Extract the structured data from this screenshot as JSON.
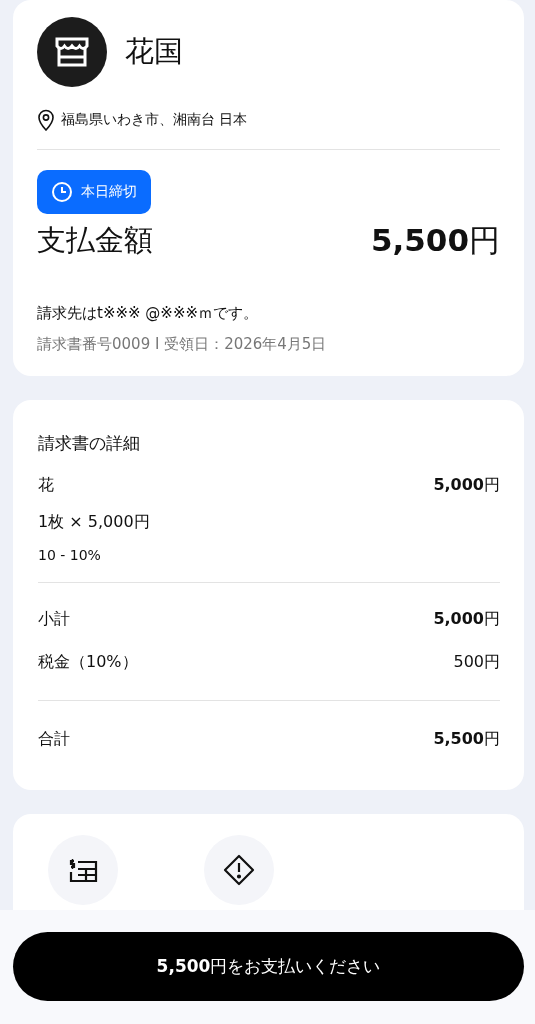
{
  "merchant": {
    "name": "花国",
    "location": "福島県いわき市、湘南台 日本"
  },
  "payment": {
    "badge": "本日締切",
    "label": "支払金額",
    "amount": "**5,500**円",
    "billed_to": "請求先はt※※※  @※※※ｍです。",
    "meta": "請求書番号0009 I 受領日：2026年4月5日"
  },
  "details": {
    "title": "請求書の詳細",
    "items": [
      {
        "name": "花",
        "amount": "**5,000**円",
        "quantity": "1枚 × 5,000円",
        "tax": "10 - 10%"
      }
    ],
    "summary": [
      {
        "label": "小計",
        "amount": "**5,000**円"
      },
      {
        "label": "税金（10%）",
        "amount": "500円"
      }
    ],
    "total": {
      "label": "合計",
      "amount": "**5,500**円"
    }
  },
  "actions": [
    {
      "kind": "receipt"
    },
    {
      "kind": "report"
    }
  ],
  "pay_button": "**5,500**円をお支払いください"
}
